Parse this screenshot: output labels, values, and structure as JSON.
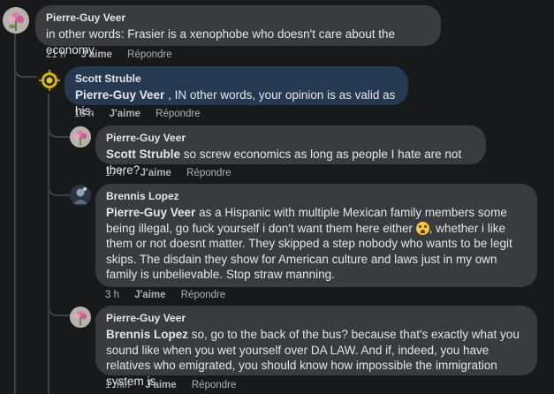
{
  "comments": [
    {
      "author": "Pierre-Guy Veer",
      "mention": "",
      "text": "in other words: Frasier is a xenophobe who doesn't care about the economy",
      "time": "21 h",
      "like": "J'aime",
      "reply": "Répondre",
      "avatar": "flower-avatar"
    },
    {
      "author": "Scott Struble",
      "mention": "Pierre-Guy Veer",
      "text": " , IN other words, your opinion is as valid as his.",
      "time": "18 h",
      "like": "J'aime",
      "reply": "Répondre",
      "avatar": "badge-avatar"
    },
    {
      "author": "Pierre-Guy Veer",
      "mention": "Scott Struble",
      "text": " so screw economics as long as people I hate are not there?",
      "time": "17 h",
      "like": "J'aime",
      "reply": "Répondre",
      "avatar": "flower-avatar"
    },
    {
      "author": "Brennis Lopez",
      "mention": "Pierre-Guy Veer",
      "text_before_emoji": " as a Hispanic with multiple Mexican family members some being illegal, go fuck yourself i don't want them here either ",
      "text_after_emoji": ", whether i like them or not doesnt matter. They skipped a step nobody who wants to be legit skips. The disdain they show for American culture and laws just in my own family is unbelievable. Stop straw manning.",
      "time": "3 h",
      "like": "J'aime",
      "reply": "Répondre",
      "avatar": "dark-avatar",
      "emoji": "crying-face-emoji"
    },
    {
      "author": "Pierre-Guy Veer",
      "mention": "Brennis Lopez",
      "text": " so, go to the back of the bus? because that's exactly what you sound like when you wet yourself over DA LAW. And if, indeed, you have relatives who emigrated, you should know how impossible the immigration system is",
      "time": "1 min",
      "like": "J'aime",
      "reply": "Répondre",
      "avatar": "flower-avatar"
    }
  ],
  "colors": {
    "background": "#18191a",
    "bubble": "#3a3b3c",
    "highlight_bubble": "#263951",
    "text": "#e4e6eb",
    "muted": "#b0b3b8"
  }
}
